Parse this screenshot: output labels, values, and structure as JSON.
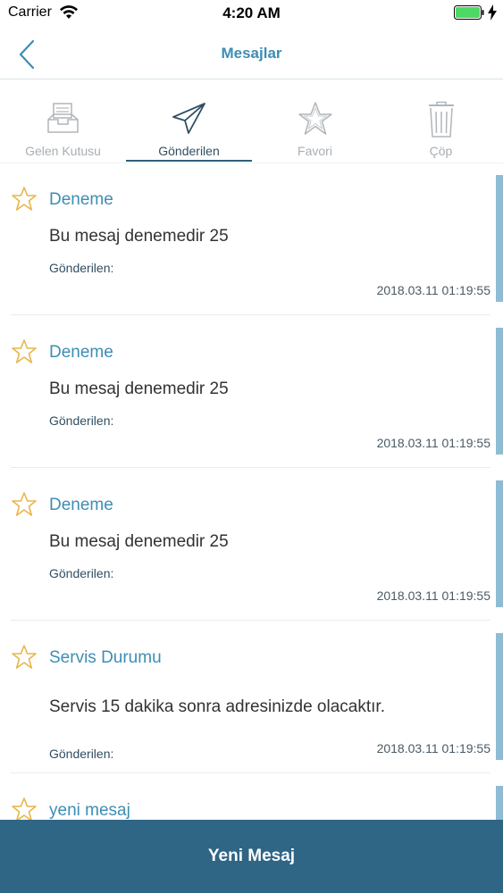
{
  "status_bar": {
    "carrier": "Carrier",
    "time": "4:20 AM"
  },
  "nav": {
    "title": "Mesajlar",
    "back_icon": "chevron-left-icon"
  },
  "tabs": [
    {
      "label": "Gelen Kutusu",
      "icon": "inbox-icon",
      "active": false
    },
    {
      "label": "Gönderilen",
      "icon": "paper-plane-icon",
      "active": true
    },
    {
      "label": "Favori",
      "icon": "star-icon",
      "active": false
    },
    {
      "label": "Çöp",
      "icon": "trash-icon",
      "active": false
    }
  ],
  "messages": [
    {
      "title": "Deneme",
      "body": "Bu mesaj  denemedir 25",
      "sender_label": "Gönderilen:",
      "date": "2018.03.11 01:19:55"
    },
    {
      "title": "Deneme",
      "body": "Bu mesaj  denemedir 25",
      "sender_label": "Gönderilen:",
      "date": "2018.03.11 01:19:55"
    },
    {
      "title": "Deneme",
      "body": "Bu mesaj  denemedir 25",
      "sender_label": "Gönderilen:",
      "date": "2018.03.11 01:19:55"
    },
    {
      "title": "Servis Durumu",
      "body": "Servis 15 dakika sonra adresinizde olacaktır.",
      "sender_label": "Gönderilen:",
      "date": "2018.03.11 01:19:55"
    },
    {
      "title": "yeni mesaj",
      "body": "",
      "sender_label": "",
      "date": ""
    }
  ],
  "new_message_button": {
    "label": "Yeni Mesaj"
  },
  "colors": {
    "accent": "#3d8eb4",
    "button_bg": "#2f6585",
    "star": "#e8b64a",
    "side_bar": "#8ebcd4"
  }
}
